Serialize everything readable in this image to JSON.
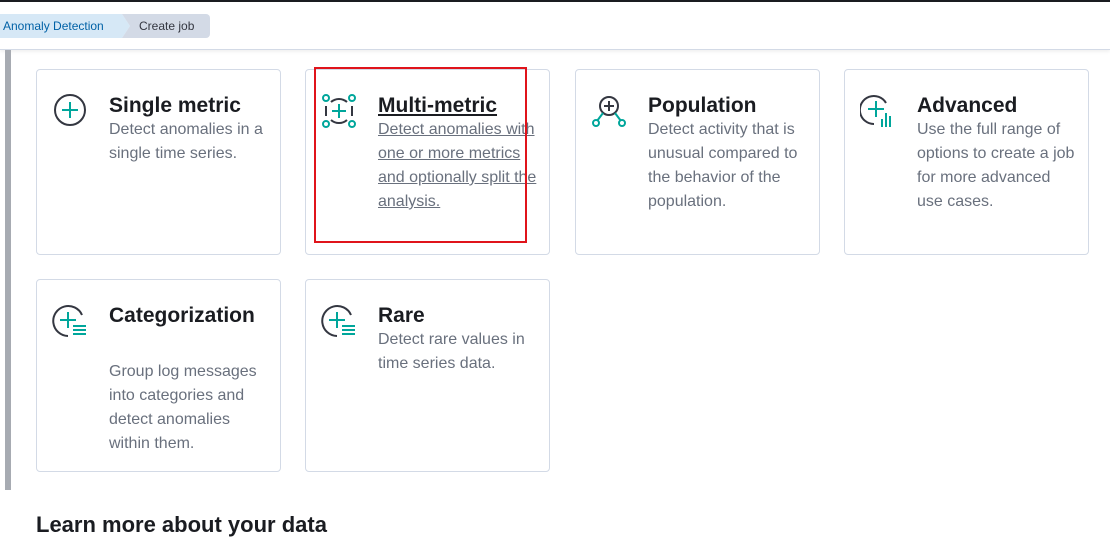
{
  "breadcrumbs": {
    "parent": "Anomaly Detection",
    "current": "Create job"
  },
  "cards": {
    "single_metric": {
      "title": "Single metric",
      "description": "Detect anomalies in a single time series."
    },
    "multi_metric": {
      "title": "Multi-metric",
      "description": "Detect anomalies with one or more metrics and optionally split the analysis."
    },
    "population": {
      "title": "Population",
      "description": "Detect activity that is unusual compared to the behavior of the population."
    },
    "advanced": {
      "title": "Advanced",
      "description": "Use the full range of options to create a job for more advanced use cases."
    },
    "categorization": {
      "title": "Categorization",
      "description": "Group log messages into categories and detect anomalies within them."
    },
    "rare": {
      "title": "Rare",
      "description": "Detect rare values in time series data."
    }
  },
  "section": {
    "learn_more": "Learn more about your data"
  },
  "colors": {
    "icon_accent": "#00a69b",
    "icon_dark": "#343741",
    "link_blue": "#0061a6",
    "highlight_red": "#e0141b"
  },
  "icons": {
    "single_metric": "plus-circle-icon",
    "multi_metric": "multi-metric-icon",
    "population": "population-icon",
    "advanced": "advanced-icon",
    "categorization": "categorization-icon",
    "rare": "rare-icon"
  }
}
